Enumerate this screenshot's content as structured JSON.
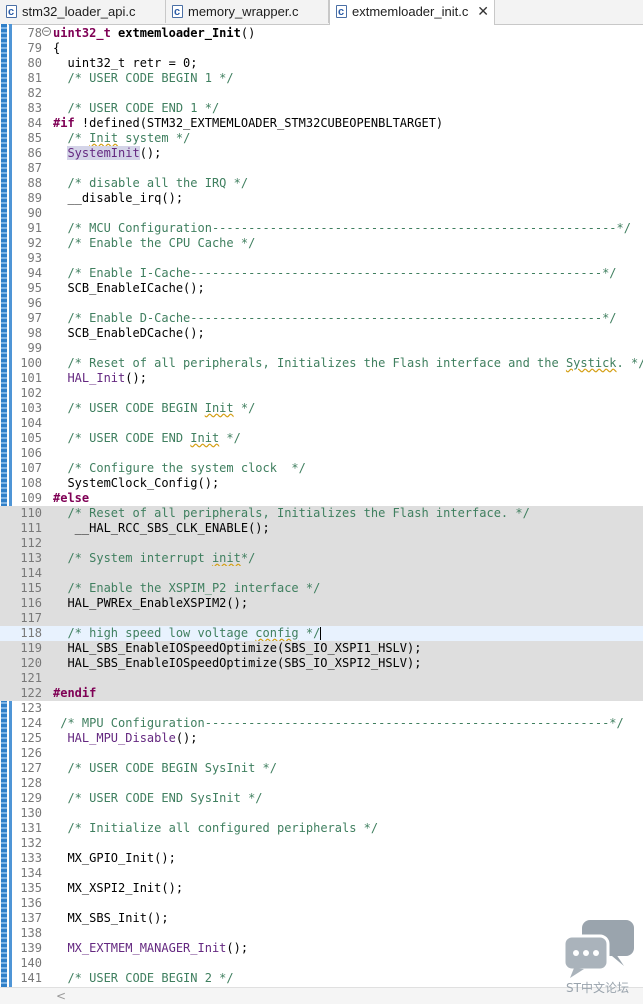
{
  "tabs": [
    {
      "label": "stm32_loader_api.c",
      "active": false
    },
    {
      "label": "memory_wrapper.c",
      "active": false
    },
    {
      "label": "extmemloader_init.c",
      "active": true,
      "close": "✕"
    }
  ],
  "fold_glyph": "−",
  "watermark": {
    "text": "ST中文论坛",
    "icon": "chat-bubbles-icon"
  },
  "scroll_arrow": "<",
  "lines": [
    {
      "n": "78",
      "fold": true,
      "s": [
        [
          "kw",
          "uint32_t"
        ],
        [
          "t",
          " "
        ],
        [
          "fn",
          "extmemloader_Init"
        ],
        [
          "t",
          "()"
        ]
      ]
    },
    {
      "n": "79",
      "s": [
        [
          "t",
          "{"
        ]
      ]
    },
    {
      "n": "80",
      "s": [
        [
          "t",
          "  uint32_t retr = 0;"
        ]
      ]
    },
    {
      "n": "81",
      "s": [
        [
          "t",
          "  "
        ],
        [
          "cm",
          "/* USER CODE BEGIN 1 */"
        ]
      ]
    },
    {
      "n": "82",
      "s": []
    },
    {
      "n": "83",
      "s": [
        [
          "t",
          "  "
        ],
        [
          "cm",
          "/* USER CODE END 1 */"
        ]
      ]
    },
    {
      "n": "84",
      "s": [
        [
          "pp",
          "#if"
        ],
        [
          "t",
          " !defined(STM32_EXTMEMLOADER_STM32CUBEOPENBLTARGET)"
        ]
      ]
    },
    {
      "n": "85",
      "s": [
        [
          "t",
          "  "
        ],
        [
          "cm",
          "/* "
        ],
        [
          "cmsq",
          "Init"
        ],
        [
          "cm",
          " system */"
        ]
      ]
    },
    {
      "n": "86",
      "s": [
        [
          "t",
          "  "
        ],
        [
          "mchl",
          "SystemInit"
        ],
        [
          "t",
          "();"
        ]
      ]
    },
    {
      "n": "87",
      "s": []
    },
    {
      "n": "88",
      "s": [
        [
          "t",
          "  "
        ],
        [
          "cm",
          "/* disable all the IRQ */"
        ]
      ]
    },
    {
      "n": "89",
      "s": [
        [
          "t",
          "  __disable_irq();"
        ]
      ]
    },
    {
      "n": "90",
      "s": []
    },
    {
      "n": "91",
      "s": [
        [
          "t",
          "  "
        ],
        [
          "cm",
          "/* MCU Configuration--------------------------------------------------------*/"
        ]
      ]
    },
    {
      "n": "92",
      "s": [
        [
          "t",
          "  "
        ],
        [
          "cm",
          "/* Enable the CPU Cache */"
        ]
      ]
    },
    {
      "n": "93",
      "s": []
    },
    {
      "n": "94",
      "s": [
        [
          "t",
          "  "
        ],
        [
          "cm",
          "/* Enable I-Cache---------------------------------------------------------*/"
        ]
      ]
    },
    {
      "n": "95",
      "s": [
        [
          "t",
          "  SCB_EnableICache();"
        ]
      ]
    },
    {
      "n": "96",
      "s": []
    },
    {
      "n": "97",
      "s": [
        [
          "t",
          "  "
        ],
        [
          "cm",
          "/* Enable D-Cache---------------------------------------------------------*/"
        ]
      ]
    },
    {
      "n": "98",
      "s": [
        [
          "t",
          "  SCB_EnableDCache();"
        ]
      ]
    },
    {
      "n": "99",
      "s": []
    },
    {
      "n": "100",
      "s": [
        [
          "t",
          "  "
        ],
        [
          "cm",
          "/* Reset of all peripherals, Initializes the Flash interface and the "
        ],
        [
          "cmsq",
          "Systick"
        ],
        [
          "cm",
          ". */"
        ]
      ]
    },
    {
      "n": "101",
      "s": [
        [
          "t",
          "  "
        ],
        [
          "mc",
          "HAL_Init"
        ],
        [
          "t",
          "();"
        ]
      ]
    },
    {
      "n": "102",
      "s": []
    },
    {
      "n": "103",
      "s": [
        [
          "t",
          "  "
        ],
        [
          "cm",
          "/* USER CODE BEGIN "
        ],
        [
          "cmsq",
          "Init"
        ],
        [
          "cm",
          " */"
        ]
      ]
    },
    {
      "n": "104",
      "s": []
    },
    {
      "n": "105",
      "s": [
        [
          "t",
          "  "
        ],
        [
          "cm",
          "/* USER CODE END "
        ],
        [
          "cmsq",
          "Init"
        ],
        [
          "cm",
          " */"
        ]
      ]
    },
    {
      "n": "106",
      "s": []
    },
    {
      "n": "107",
      "s": [
        [
          "t",
          "  "
        ],
        [
          "cm",
          "/* Configure the system clock  */"
        ]
      ]
    },
    {
      "n": "108",
      "s": [
        [
          "t",
          "  SystemClock_Config();"
        ]
      ]
    },
    {
      "n": "109",
      "s": [
        [
          "pp",
          "#else"
        ]
      ]
    },
    {
      "n": "110",
      "inactive": true,
      "s": [
        [
          "t",
          "  "
        ],
        [
          "cm",
          "/* Reset of all peripherals, Initializes the Flash interface. */"
        ]
      ]
    },
    {
      "n": "111",
      "inactive": true,
      "s": [
        [
          "t",
          "   __HAL_RCC_SBS_CLK_ENABLE();"
        ]
      ]
    },
    {
      "n": "112",
      "inactive": true,
      "s": []
    },
    {
      "n": "113",
      "inactive": true,
      "s": [
        [
          "t",
          "  "
        ],
        [
          "cm",
          "/* System interrupt "
        ],
        [
          "cmsq",
          "init"
        ],
        [
          "cm",
          "*/"
        ]
      ]
    },
    {
      "n": "114",
      "inactive": true,
      "s": []
    },
    {
      "n": "115",
      "inactive": true,
      "s": [
        [
          "t",
          "  "
        ],
        [
          "cm",
          "/* Enable the XSPIM_P2 interface */"
        ]
      ]
    },
    {
      "n": "116",
      "inactive": true,
      "s": [
        [
          "t",
          "  HAL_PWREx_EnableXSPIM2();"
        ]
      ]
    },
    {
      "n": "117",
      "inactive": true,
      "s": []
    },
    {
      "n": "118",
      "current": true,
      "s": [
        [
          "t",
          "  "
        ],
        [
          "cm",
          "/* high speed low voltage "
        ],
        [
          "cmsq",
          "config"
        ],
        [
          "cm",
          " */"
        ],
        [
          "caret",
          ""
        ]
      ]
    },
    {
      "n": "119",
      "inactive": true,
      "s": [
        [
          "t",
          "  HAL_SBS_EnableIOSpeedOptimize(SBS_IO_XSPI1_HSLV);"
        ]
      ]
    },
    {
      "n": "120",
      "inactive": true,
      "s": [
        [
          "t",
          "  HAL_SBS_EnableIOSpeedOptimize(SBS_IO_XSPI2_HSLV);"
        ]
      ]
    },
    {
      "n": "121",
      "inactive": true,
      "s": []
    },
    {
      "n": "122",
      "inactive": true,
      "s": [
        [
          "pp",
          "#endif"
        ]
      ]
    },
    {
      "n": "123",
      "s": []
    },
    {
      "n": "124",
      "s": [
        [
          "t",
          " "
        ],
        [
          "cm",
          "/* MPU Configuration--------------------------------------------------------*/"
        ]
      ]
    },
    {
      "n": "125",
      "s": [
        [
          "t",
          "  "
        ],
        [
          "mc",
          "HAL_MPU_Disable"
        ],
        [
          "t",
          "();"
        ]
      ]
    },
    {
      "n": "126",
      "s": []
    },
    {
      "n": "127",
      "s": [
        [
          "t",
          "  "
        ],
        [
          "cm",
          "/* USER CODE BEGIN SysInit */"
        ]
      ]
    },
    {
      "n": "128",
      "s": []
    },
    {
      "n": "129",
      "s": [
        [
          "t",
          "  "
        ],
        [
          "cm",
          "/* USER CODE END SysInit */"
        ]
      ]
    },
    {
      "n": "130",
      "s": []
    },
    {
      "n": "131",
      "s": [
        [
          "t",
          "  "
        ],
        [
          "cm",
          "/* Initialize all configured peripherals */"
        ]
      ]
    },
    {
      "n": "132",
      "s": []
    },
    {
      "n": "133",
      "s": [
        [
          "t",
          "  MX_GPIO_Init();"
        ]
      ]
    },
    {
      "n": "134",
      "s": []
    },
    {
      "n": "135",
      "s": [
        [
          "t",
          "  MX_XSPI2_Init();"
        ]
      ]
    },
    {
      "n": "136",
      "s": []
    },
    {
      "n": "137",
      "s": [
        [
          "t",
          "  MX_SBS_Init();"
        ]
      ]
    },
    {
      "n": "138",
      "s": []
    },
    {
      "n": "139",
      "s": [
        [
          "t",
          "  "
        ],
        [
          "mc",
          "MX_EXTMEM_MANAGER_Init"
        ],
        [
          "t",
          "();"
        ]
      ]
    },
    {
      "n": "140",
      "s": []
    },
    {
      "n": "141",
      "s": [
        [
          "t",
          "  "
        ],
        [
          "cm",
          "/* USER CODE BEGIN 2 */"
        ]
      ]
    }
  ]
}
